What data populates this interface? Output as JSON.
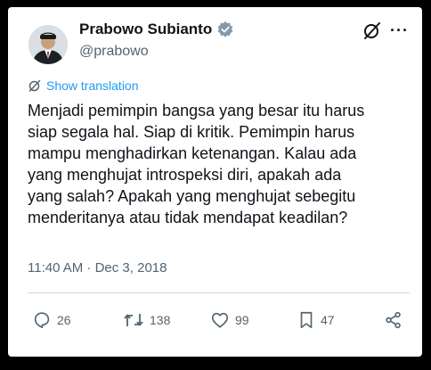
{
  "user": {
    "name": "Prabowo Subianto",
    "handle": "@prabowo"
  },
  "translate_label": "Show translation",
  "tweet": {
    "text": "Menjadi pemimpin bangsa yang besar itu harus\nsiap segala hal. Siap di kritik. Pemimpin harus\nmampu menghadirkan ketenangan. Kalau ada\nyang menghujat introspeksi diri, apakah ada\nyang salah? Apakah yang menghujat sebegitu\nmenderitanya atau tidak mendapat keadilan?",
    "timestamp": "11:40 AM · Dec 3, 2018"
  },
  "actions": {
    "replies": "26",
    "reposts": "138",
    "likes": "99",
    "bookmarks": "47"
  },
  "colors": {
    "accent": "#1d9bf0",
    "muted": "#536471",
    "text": "#0f1419"
  }
}
